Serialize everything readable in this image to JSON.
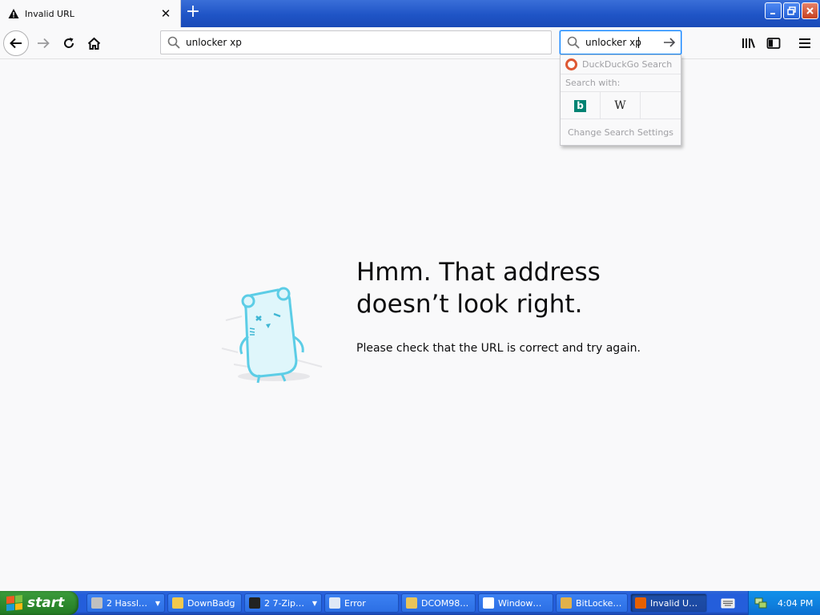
{
  "browser": {
    "tab": {
      "title": "Invalid URL"
    },
    "url_bar": {
      "value": "unlocker xp"
    },
    "search_bar": {
      "value": "unlocker xp"
    }
  },
  "search_popup": {
    "engine_label": "DuckDuckGo Search",
    "search_with": "Search with:",
    "engines": [
      "Bing",
      "Wikipedia"
    ],
    "wiki_glyph": "W",
    "bing_glyph": "b",
    "settings_label": "Change Search Settings"
  },
  "error_page": {
    "title": "Hmm. That address doesn’t look right.",
    "description": "Please check that the URL is correct and try again."
  },
  "taskbar": {
    "start_label": "start",
    "tasks": [
      {
        "label": "2 Hassl…",
        "icon_color": "#c0c0c0",
        "group": true
      },
      {
        "label": "DownBadg",
        "icon_color": "#f3c94d",
        "group": false
      },
      {
        "label": "2 7-Zip…",
        "icon_color": "#222222",
        "group": true
      },
      {
        "label": "Error",
        "icon_color": "#dfe8f6",
        "group": false
      },
      {
        "label": "DCOM98…",
        "icon_color": "#e9c45a",
        "group": false
      },
      {
        "label": "Window…",
        "icon_color": "#ffffff",
        "group": false
      },
      {
        "label": "BitLocke…",
        "icon_color": "#e2b14a",
        "group": false
      },
      {
        "label": "Invalid U…",
        "icon_color": "#e66000",
        "group": false,
        "active": true
      }
    ],
    "clock": "4:04 PM"
  },
  "colors": {
    "accent": "#0a84ff",
    "xp_blue": "#245edb",
    "start_green": "#2f8b2f"
  }
}
